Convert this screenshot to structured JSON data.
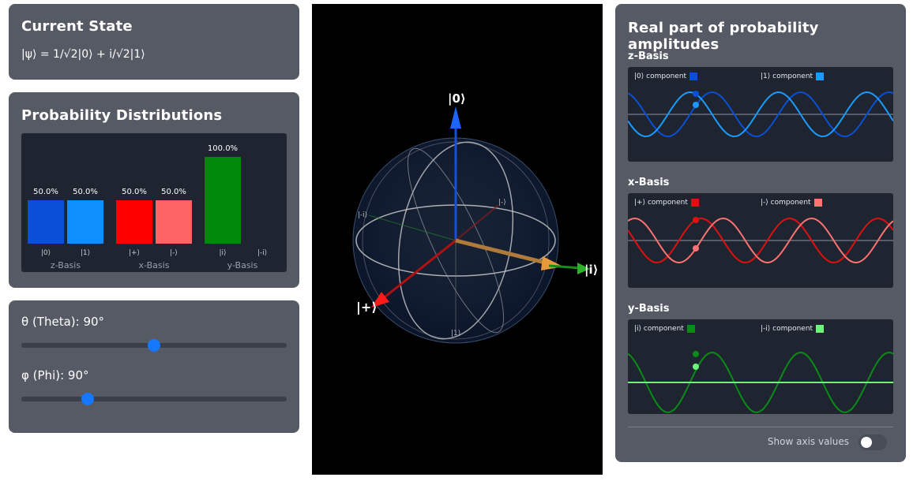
{
  "state": {
    "title": "Current State",
    "equation": "|ψ⟩ = 1/√2|0⟩ + i/√2|1⟩"
  },
  "probabilities": {
    "title": "Probability Distributions",
    "bars": [
      {
        "label": "|0⟩",
        "value": 50.0,
        "value_text": "50.0%",
        "color": "#0a4fd6"
      },
      {
        "label": "|1⟩",
        "value": 50.0,
        "value_text": "50.0%",
        "color": "#0f8fff"
      },
      {
        "label": "|+⟩",
        "value": 50.0,
        "value_text": "50.0%",
        "color": "#ff0000"
      },
      {
        "label": "|-⟩",
        "value": 50.0,
        "value_text": "50.0%",
        "color": "#ff6464"
      },
      {
        "label": "|i⟩",
        "value": 100.0,
        "value_text": "100.0%",
        "color": "#00880a"
      },
      {
        "label": "|-i⟩",
        "value": 0.0,
        "value_text": "",
        "color": "#5cf06a"
      }
    ],
    "basis_labels": [
      "z-Basis",
      "x-Basis",
      "y-Basis"
    ]
  },
  "controls": {
    "theta_label": "θ (Theta): 90°",
    "theta_fraction": 0.5,
    "phi_label": "φ (Phi): 90°",
    "phi_fraction": 0.25
  },
  "sphere": {
    "labels": {
      "zero": "|0⟩",
      "one": "|1⟩",
      "plus": "|+⟩",
      "minus": "|-⟩",
      "i": "|i⟩",
      "minus_i": "|-i⟩"
    }
  },
  "amplitudes": {
    "title": "Real part of probability amplitudes",
    "panels": [
      {
        "name": "z-Basis",
        "legend": [
          "|0⟩ component",
          "|1⟩ component"
        ],
        "colors": [
          "#0a4fd6",
          "#1a9bff"
        ]
      },
      {
        "name": "x-Basis",
        "legend": [
          "|+⟩ component",
          "|-⟩ component"
        ],
        "colors": [
          "#e01010",
          "#ff7272"
        ]
      },
      {
        "name": "y-Basis",
        "legend": [
          "|i⟩ component",
          "|-i⟩ component"
        ],
        "colors": [
          "#0a8c14",
          "#6cf57a"
        ]
      }
    ],
    "toggle_label": "Show axis values",
    "toggle_on": false
  }
}
